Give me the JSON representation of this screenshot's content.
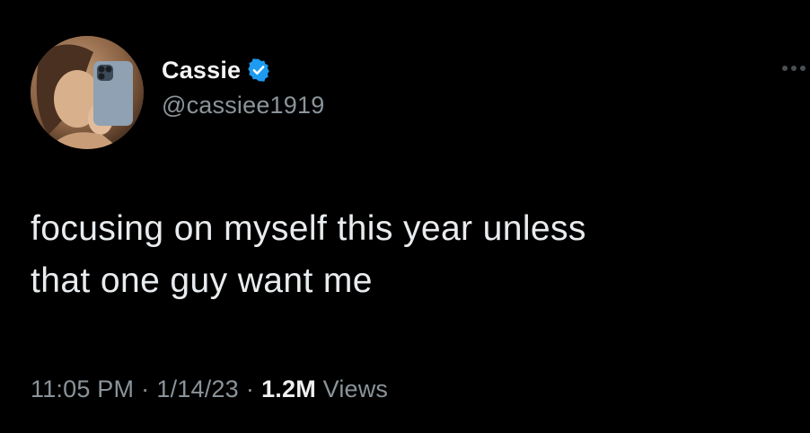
{
  "tweet": {
    "display_name": "Cassie",
    "handle": "@cassiee1919",
    "verified": true,
    "verified_color": "#1d9bf0",
    "text_lines": [
      "focusing on myself this year unless",
      "that one guy want me"
    ],
    "time": "11:05 PM",
    "separator": "·",
    "date": "1/14/23",
    "view_count": "1.2M",
    "view_label": "Views",
    "more_icon": "more-horizontal-icon",
    "background": "#000000"
  }
}
